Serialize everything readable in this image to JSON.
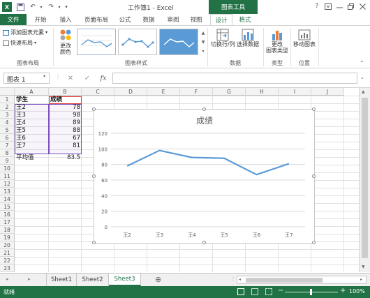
{
  "window": {
    "title": "工作簿1 - Excel",
    "context_group": "图表工具",
    "help_icon": "?",
    "buttons": [
      "minimize-icon",
      "restore-icon",
      "close-icon"
    ]
  },
  "qat": {
    "logo": "X",
    "save": "💾",
    "undo": "↶",
    "redo": "↷"
  },
  "tabs": {
    "file": "文件",
    "home": "开始",
    "insert": "插入",
    "layout": "页面布局",
    "formulas": "公式",
    "data": "数据",
    "review": "审阅",
    "view": "视图",
    "design": "设计",
    "format": "格式"
  },
  "ribbon": {
    "add_element": "添加图表元素",
    "quick_layout": "快速布局",
    "group_layouts": "图表布局",
    "change_colors_l1": "更改",
    "change_colors_l2": "颜色",
    "group_styles": "图表样式",
    "switch_row_col": "切换行/列",
    "select_data": "选择数据",
    "group_data": "数据",
    "change_type_l1": "更改",
    "change_type_l2": "图表类型",
    "group_type": "类型",
    "move_chart": "移动图表",
    "group_location": "位置"
  },
  "formula_bar": {
    "name_box": "图表 1",
    "cancel": "✕",
    "enter": "✓",
    "fx": "fx"
  },
  "grid": {
    "columns": [
      "A",
      "B",
      "C",
      "D",
      "E",
      "F",
      "G",
      "H",
      "I",
      "J"
    ],
    "rows": [
      "1",
      "2",
      "3",
      "4",
      "5",
      "6",
      "7",
      "8",
      "9",
      "10",
      "11",
      "12",
      "13",
      "14",
      "15",
      "16",
      "17",
      "18",
      "19",
      "20",
      "21",
      "22",
      "23"
    ],
    "header_a": "学生",
    "header_b": "成绩",
    "names": [
      "王2",
      "王3",
      "王4",
      "王5",
      "王6",
      "王7"
    ],
    "scores": [
      "78",
      "98",
      "89",
      "88",
      "67",
      "81"
    ],
    "avg_label": "平均值",
    "avg_value": "83.5"
  },
  "chart_data": {
    "type": "line",
    "title": "成绩",
    "categories": [
      "王2",
      "王3",
      "王4",
      "王5",
      "王6",
      "王7"
    ],
    "series": [
      {
        "values": [
          78,
          98,
          89,
          88,
          67,
          81
        ]
      }
    ],
    "ylim": [
      0,
      120
    ],
    "yticks": [
      "0",
      "20",
      "40",
      "60",
      "80",
      "100",
      "120"
    ],
    "grid": true,
    "legend": "none",
    "line_color": "#5b9bd5"
  },
  "sheets": {
    "tab1": "Sheet1",
    "tab2": "Sheet2",
    "tab3": "Sheet3",
    "add": "⊕"
  },
  "status": {
    "ready": "就绪",
    "zoom": "100%",
    "minus": "−",
    "plus": "+"
  },
  "colors": {
    "accent": "#217346",
    "chart_line": "#5b9bd5",
    "selection_b": "#7b4dbf",
    "selection_h": "#e03a3a"
  }
}
